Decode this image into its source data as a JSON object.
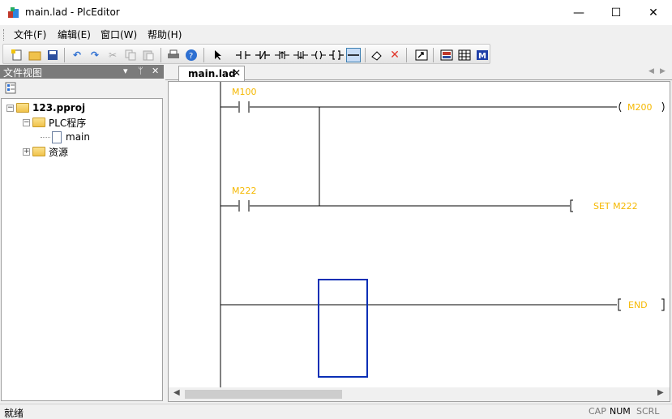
{
  "window": {
    "title": "main.lad - PlcEditor",
    "minimize": "—",
    "maximize": "☐",
    "close": "✕"
  },
  "menu": [
    {
      "label": "文件(F)"
    },
    {
      "label": "编辑(E)"
    },
    {
      "label": "窗口(W)"
    },
    {
      "label": "帮助(H)"
    }
  ],
  "toolbar": {
    "icons": [
      "new-icon",
      "open-icon",
      "save-icon",
      "undo-icon",
      "redo-icon",
      "cut-icon",
      "copy-icon",
      "paste-icon",
      "print-icon",
      "help-icon",
      "pointer-icon",
      "no-contact-icon",
      "nc-contact-icon",
      "pos-edge-icon",
      "neg-edge-icon",
      "coil-icon",
      "instruction-icon",
      "hline-icon",
      "erase-icon",
      "delete-line-icon",
      "compile-icon",
      "monitor-icon",
      "table-icon",
      "m-icon"
    ]
  },
  "file_view": {
    "title": "文件视图",
    "project": "123.pproj",
    "plc_folder": "PLC程序",
    "main_file": "main",
    "resources": "资源"
  },
  "tab": {
    "label": "main.lad",
    "close": "✕"
  },
  "ladder": {
    "rung1": {
      "contact": "M100",
      "coil": "M200"
    },
    "rung2": {
      "contact": "M222",
      "instruction": "SET M222"
    },
    "rung3": {
      "instruction": "END"
    },
    "line_color": "#000000",
    "label_color": "#f5b800",
    "cursor_color": "#0a2fb5"
  },
  "status": {
    "text": "就绪",
    "cap": "CAP",
    "num": "NUM",
    "scrl": "SCRL"
  }
}
